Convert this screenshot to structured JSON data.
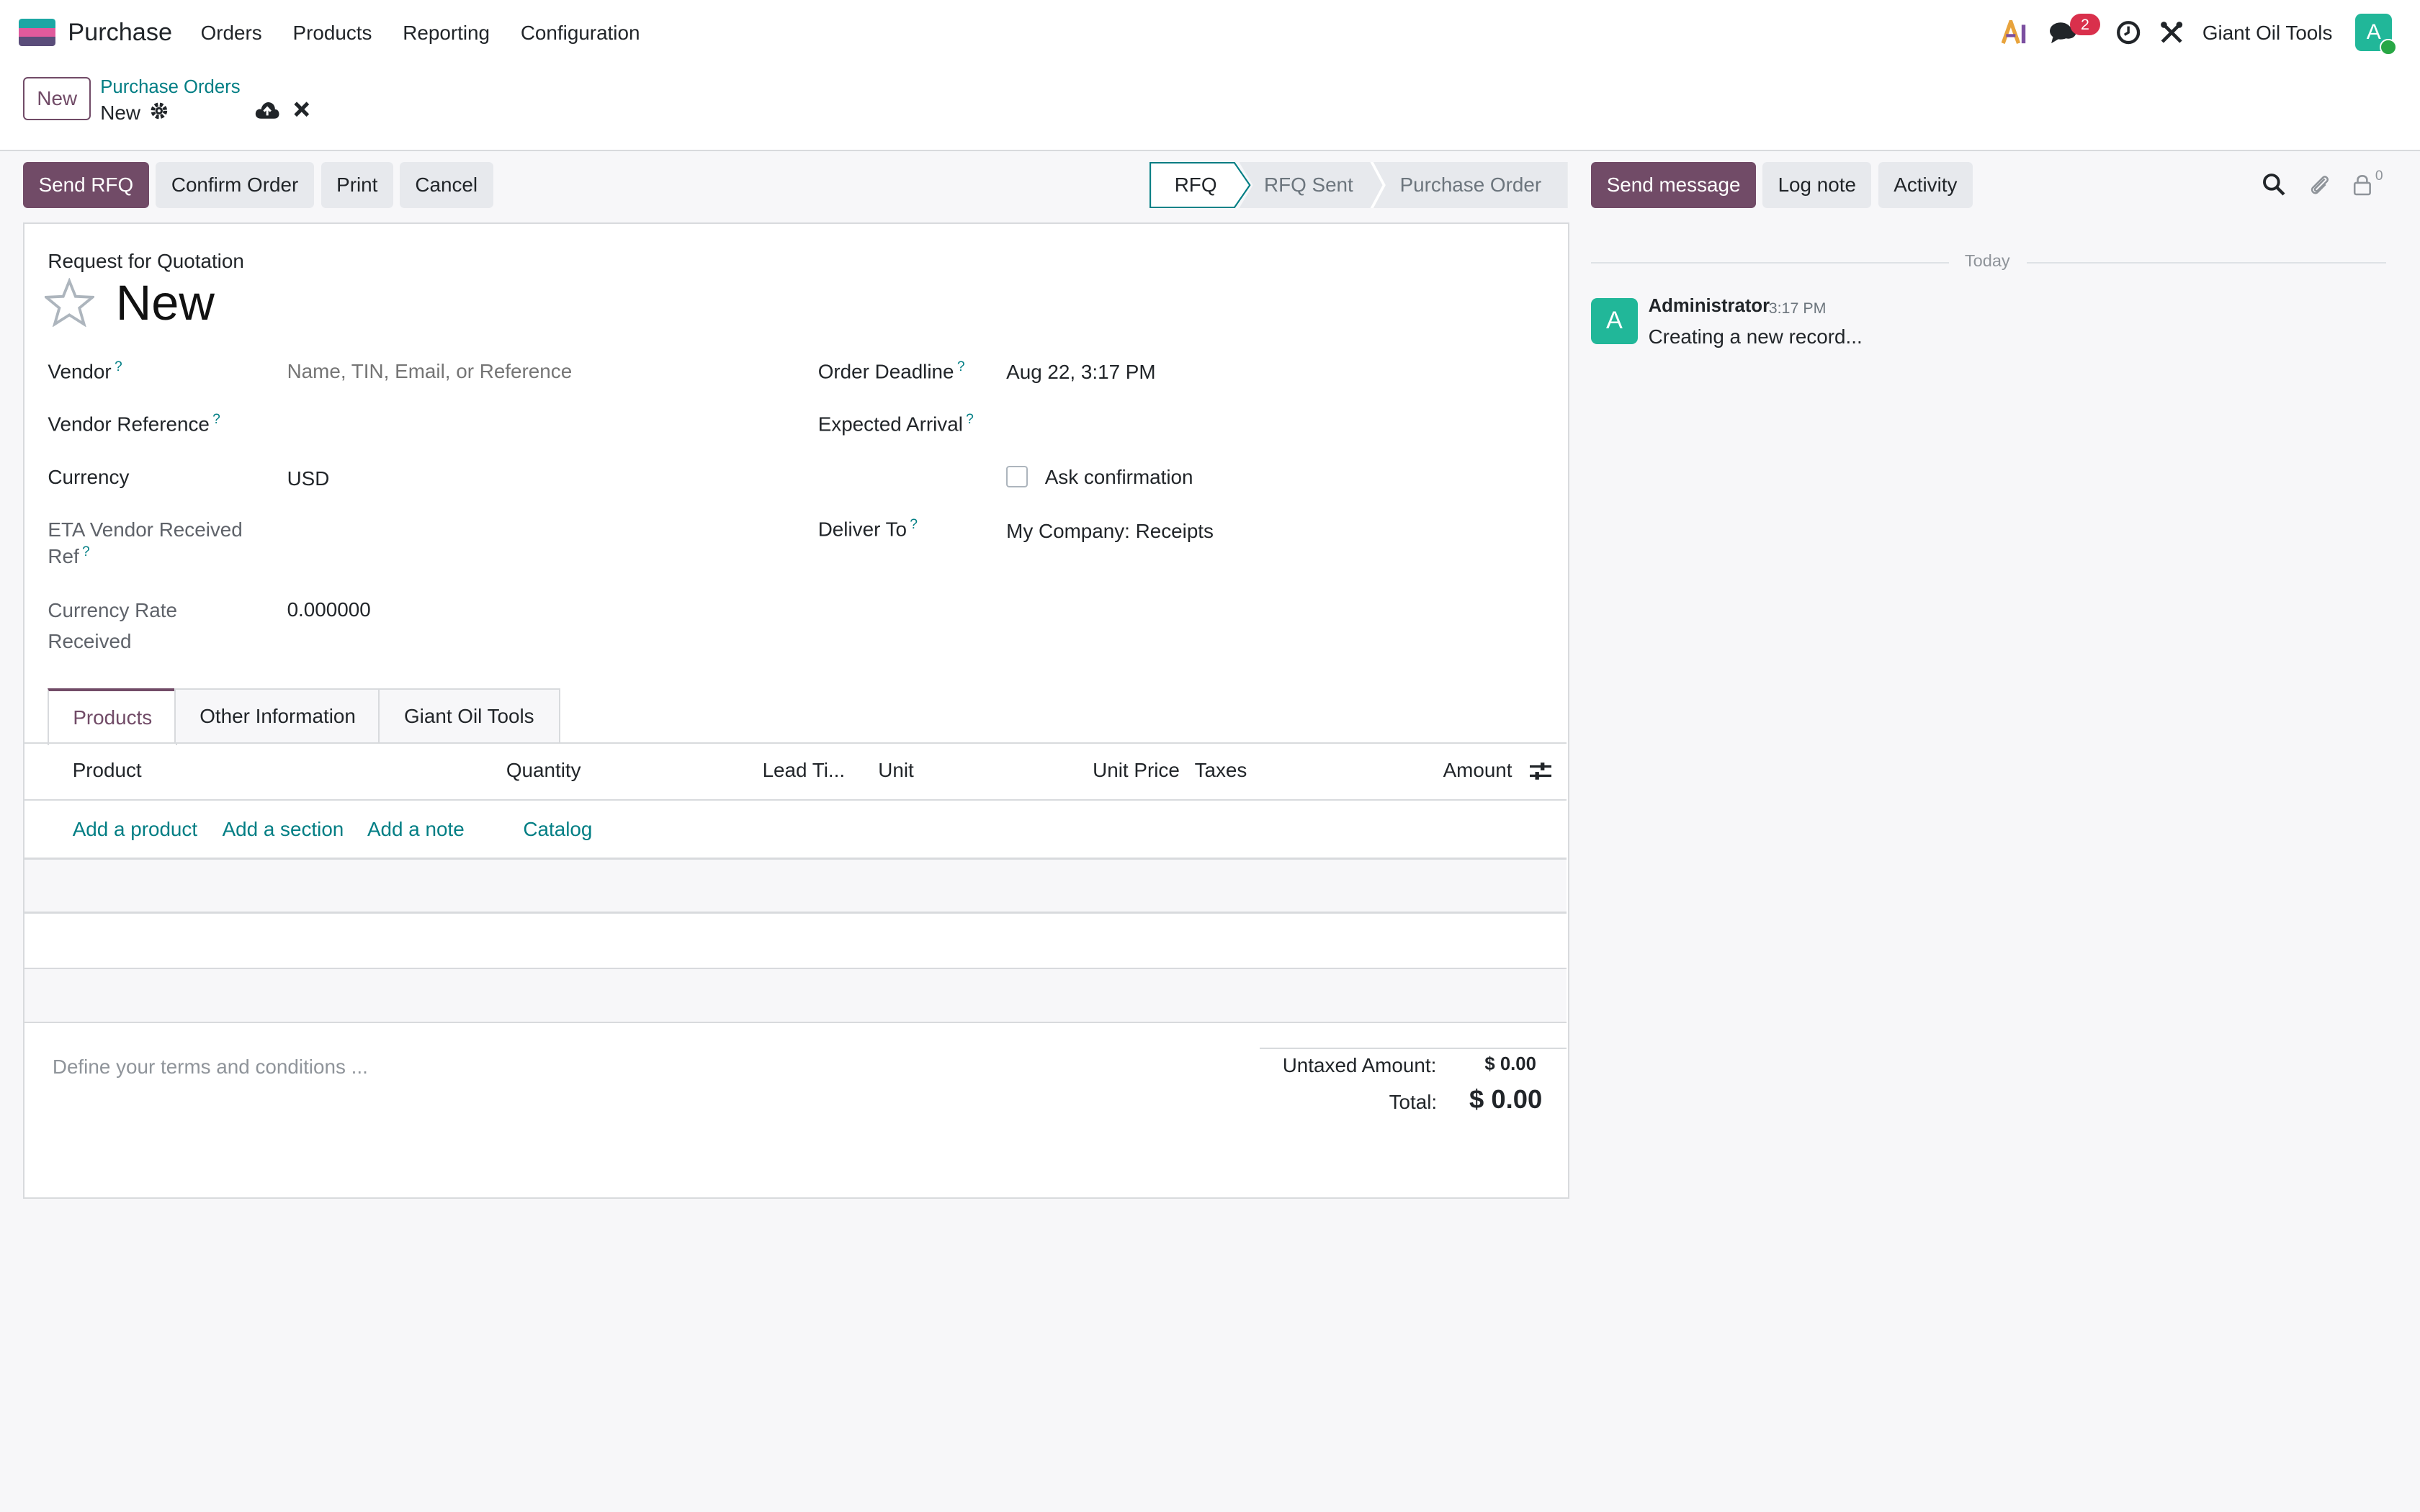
{
  "app": {
    "name": "Purchase",
    "logo_colors": [
      "#1ca7a4",
      "#e05a9c",
      "#5a4d7a"
    ],
    "menu": [
      "Orders",
      "Products",
      "Reporting",
      "Configuration"
    ]
  },
  "systray": {
    "message_count": "2",
    "company": "Giant Oil Tools",
    "user_initial": "A"
  },
  "breadcrumb": {
    "new_button": "New",
    "parent": "Purchase Orders",
    "current": "New"
  },
  "actions": {
    "send_rfq": "Send RFQ",
    "confirm_order": "Confirm Order",
    "print": "Print",
    "cancel": "Cancel"
  },
  "status": {
    "steps": [
      "RFQ",
      "RFQ Sent",
      "Purchase Order"
    ],
    "active": "RFQ"
  },
  "form": {
    "doc_type": "Request for Quotation",
    "title": "New",
    "vendor_label": "Vendor",
    "vendor_placeholder": "Name, TIN, Email, or Reference",
    "vendor_ref_label": "Vendor Reference",
    "currency_label": "Currency",
    "currency_value": "USD",
    "eta_label_line1": "ETA Vendor Received",
    "eta_label_line2": "Ref",
    "rate_label_line1": "Currency Rate",
    "rate_label_line2": "Received",
    "rate_value": "0.000000",
    "deadline_label": "Order Deadline",
    "deadline_value": "Aug 22, 3:17 PM",
    "arrival_label": "Expected Arrival",
    "ask_confirmation_label": "Ask confirmation",
    "deliver_to_label": "Deliver To",
    "deliver_to_value": "My Company: Receipts",
    "help_mark": "?"
  },
  "tabs": [
    "Products",
    "Other Information",
    "Giant Oil Tools"
  ],
  "lines": {
    "columns": [
      "Product",
      "Quantity",
      "Lead Ti...",
      "Unit",
      "Unit Price",
      "Taxes",
      "Amount"
    ],
    "add_links": [
      "Add a product",
      "Add a section",
      "Add a note",
      "Catalog"
    ]
  },
  "footer": {
    "terms_placeholder": "Define your terms and conditions ...",
    "untaxed_label": "Untaxed Amount:",
    "untaxed_value": "$ 0.00",
    "total_label": "Total:",
    "total_value": "$ 0.00"
  },
  "chatter": {
    "send_message": "Send message",
    "log_note": "Log note",
    "activity": "Activity",
    "follower_count": "0",
    "date_separator": "Today",
    "message": {
      "author": "Administrator",
      "time": "3:17 PM",
      "body": "Creating a new record...",
      "initial": "A"
    }
  }
}
